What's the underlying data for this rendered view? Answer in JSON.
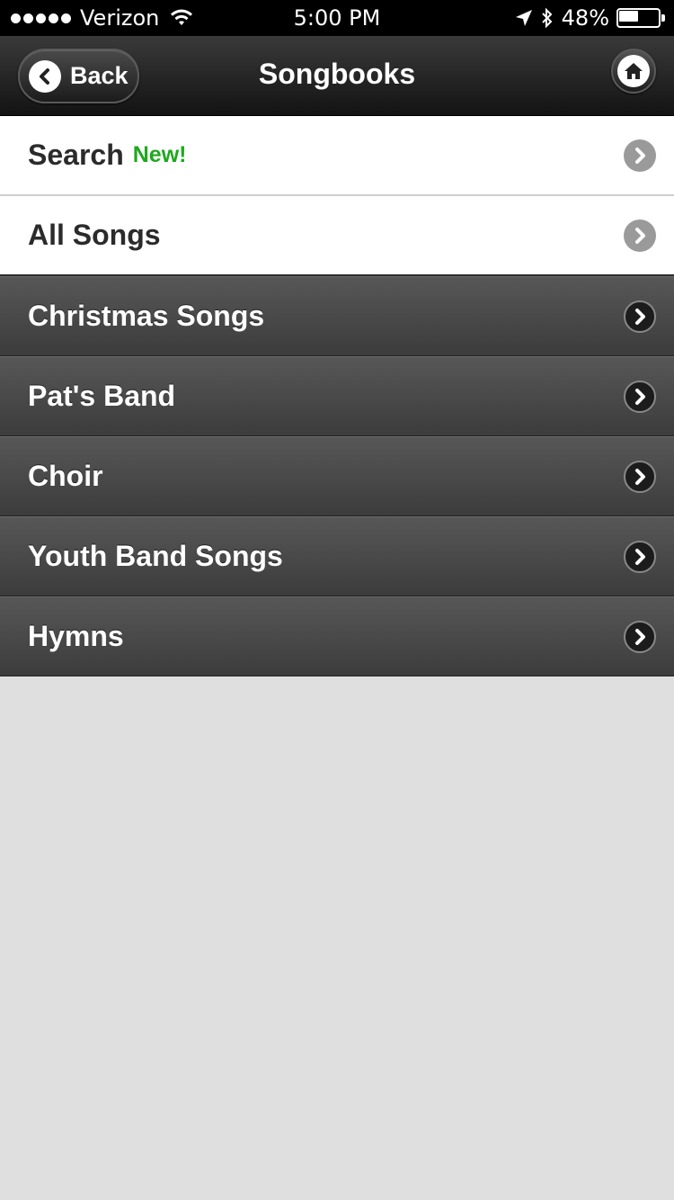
{
  "status_bar": {
    "carrier": "Verizon",
    "time": "5:00 PM",
    "battery": "48%",
    "battery_level": 0.48,
    "icons": [
      "signal-dots-icon",
      "wifi-icon",
      "location-arrow-icon",
      "bluetooth-icon",
      "battery-icon"
    ]
  },
  "nav": {
    "back_label": "Back",
    "title": "Songbooks",
    "icons": [
      "chevron-left-icon",
      "home-icon"
    ]
  },
  "list": {
    "top_items": [
      {
        "label": "Search",
        "badge": "New!"
      },
      {
        "label": "All Songs"
      }
    ],
    "songbooks": [
      {
        "label": "Christmas Songs"
      },
      {
        "label": "Pat's Band"
      },
      {
        "label": "Choir"
      },
      {
        "label": "Youth Band Songs"
      },
      {
        "label": "Hymns"
      }
    ]
  },
  "colors": {
    "badge_green": "#1ea81e",
    "page_background": "#dfdfdf",
    "nav_background": "#1e1e1e",
    "dark_row": "#4a4a4a"
  }
}
